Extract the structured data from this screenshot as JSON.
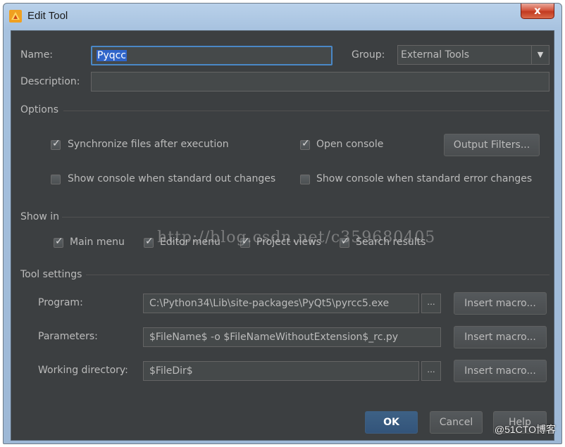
{
  "window": {
    "title": "Edit Tool",
    "close_label": "x"
  },
  "form": {
    "name_label": "Name:",
    "name_value": "Pyqcc",
    "group_label": "Group:",
    "group_value": "External Tools",
    "description_label": "Description:",
    "description_value": ""
  },
  "options": {
    "title": "Options",
    "sync_files": {
      "label": "Synchronize files after execution",
      "checked": true
    },
    "open_console": {
      "label": "Open console",
      "checked": true
    },
    "output_filters_label": "Output Filters...",
    "show_console_out": {
      "label": "Show console when standard out changes",
      "checked": false
    },
    "show_console_err": {
      "label": "Show console when standard error changes",
      "checked": false
    }
  },
  "show_in": {
    "title": "Show in",
    "main_menu": {
      "label": "Main menu",
      "checked": true
    },
    "editor_menu": {
      "label": "Editor menu",
      "checked": true
    },
    "project_views": {
      "label": "Project views",
      "checked": true
    },
    "search_results": {
      "label": "Search results",
      "checked": true
    }
  },
  "tool_settings": {
    "title": "Tool settings",
    "program_label": "Program:",
    "program_value": "C:\\Python34\\Lib\\site-packages\\PyQt5\\pyrcc5.exe",
    "parameters_label": "Parameters:",
    "parameters_value": "$FileName$ -o $FileNameWithoutExtension$_rc.py",
    "working_dir_label": "Working directory:",
    "working_dir_value": "$FileDir$",
    "browse_label": "...",
    "insert_macro_label": "Insert macro..."
  },
  "buttons": {
    "ok": "OK",
    "cancel": "Cancel",
    "help": "Help"
  },
  "watermark": "http://blog.csdn.net/c359680405",
  "corner_mark": "@51CTO博客",
  "colors": {
    "dialog_bg": "#3c3f41",
    "selection": "#2f65ca",
    "focus_border": "#4a88c7"
  }
}
